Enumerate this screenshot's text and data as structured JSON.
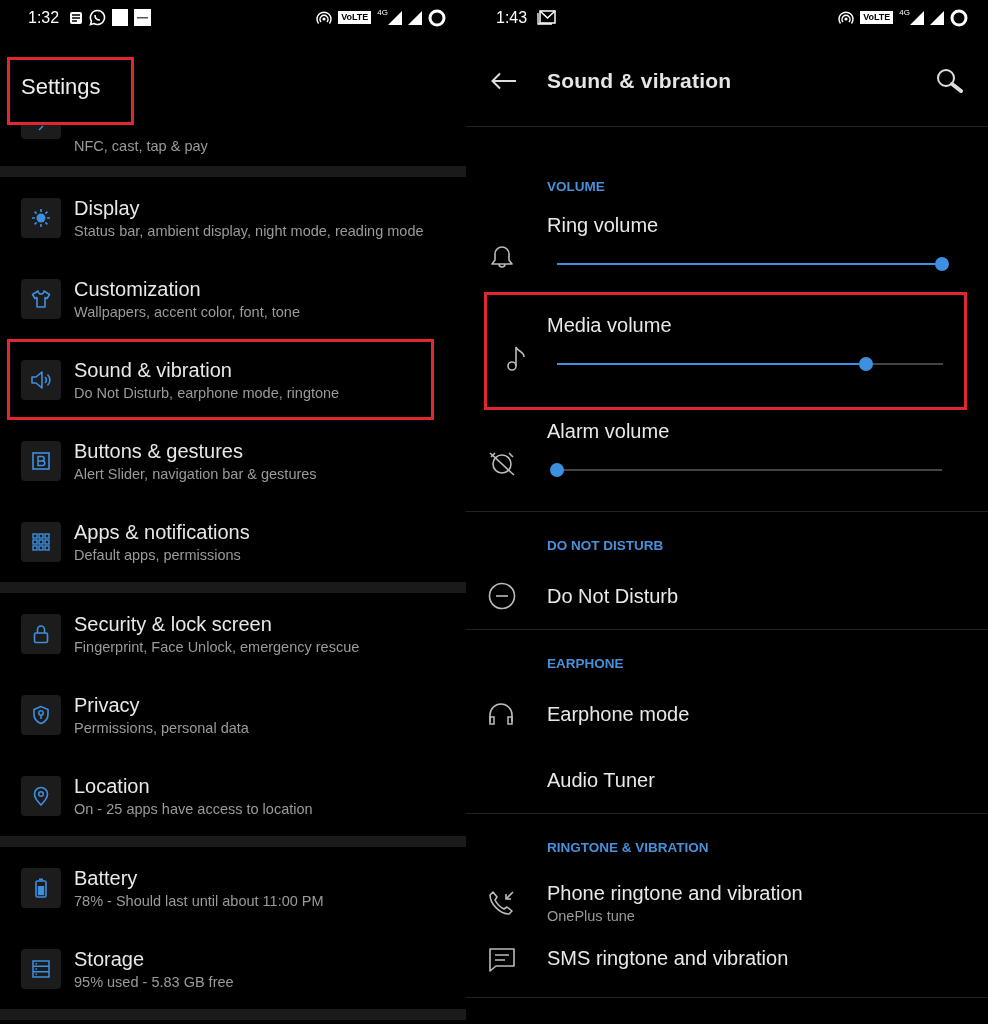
{
  "left": {
    "status_bar": {
      "time": "1:32",
      "network_badge": "VoLTE",
      "network_type": "4G"
    },
    "title": {
      "text": "Settings",
      "highlighted": true
    },
    "groups": [
      [
        {
          "kind": "cut",
          "subtitle": "NFC, cast, tap & pay",
          "highlighted": false
        }
      ],
      [
        {
          "kind": "full",
          "title": "Display",
          "subtitle": "Status bar, ambient display, night mode, reading mode",
          "highlighted": false
        },
        {
          "kind": "full",
          "title": "Customization",
          "subtitle": "Wallpapers, accent color, font, tone",
          "highlighted": false
        },
        {
          "kind": "full",
          "title": "Sound & vibration",
          "subtitle": "Do Not Disturb, earphone mode, ringtone",
          "highlighted": true
        },
        {
          "kind": "full",
          "title": "Buttons & gestures",
          "subtitle": "Alert Slider, navigation bar & gestures",
          "highlighted": false
        },
        {
          "kind": "full",
          "title": "Apps & notifications",
          "subtitle": "Default apps, permissions",
          "highlighted": false
        }
      ],
      [
        {
          "kind": "full",
          "title": "Security & lock screen",
          "subtitle": "Fingerprint, Face Unlock, emergency rescue",
          "highlighted": false
        },
        {
          "kind": "full",
          "title": "Privacy",
          "subtitle": "Permissions, personal data",
          "highlighted": false
        },
        {
          "kind": "full",
          "title": "Location",
          "subtitle": "On - 25 apps have access to location",
          "highlighted": false
        }
      ],
      [
        {
          "kind": "full",
          "title": "Battery",
          "subtitle": "78% - Should last until about 11:00 PM",
          "highlighted": false
        },
        {
          "kind": "full",
          "title": "Storage",
          "subtitle": "95% used - 5.83 GB free",
          "highlighted": false
        }
      ]
    ]
  },
  "right": {
    "status_bar": {
      "time": "1:43",
      "network_badge": "VoLTE",
      "network_type": "4G"
    },
    "toolbar": {
      "title": "Sound & vibration"
    },
    "sections": [
      {
        "header": "VOLUME",
        "items": [
          {
            "kind": "slider",
            "label": "Ring volume",
            "level": 1,
            "highlighted": false
          },
          {
            "kind": "slider",
            "label": "Media volume",
            "level": 0.8,
            "highlighted": true
          },
          {
            "kind": "slider",
            "label": "Alarm volume",
            "level": 0,
            "highlighted": false
          }
        ]
      },
      {
        "header": "DO NOT DISTURB",
        "items": [
          {
            "kind": "plain",
            "label": "Do Not Disturb",
            "highlighted": false
          }
        ]
      },
      {
        "header": "EARPHONE",
        "items": [
          {
            "kind": "plain",
            "label": "Earphone mode",
            "highlighted": false
          },
          {
            "kind": "plain",
            "label": "Audio Tuner",
            "highlighted": false
          }
        ]
      },
      {
        "header": "RINGTONE & VIBRATION",
        "items": [
          {
            "kind": "sub",
            "label": "Phone ringtone and vibration",
            "subtitle": "OnePlus tune",
            "highlighted": false
          },
          {
            "kind": "sub",
            "label": "SMS ringtone and vibration",
            "highlighted": false
          }
        ]
      }
    ]
  }
}
